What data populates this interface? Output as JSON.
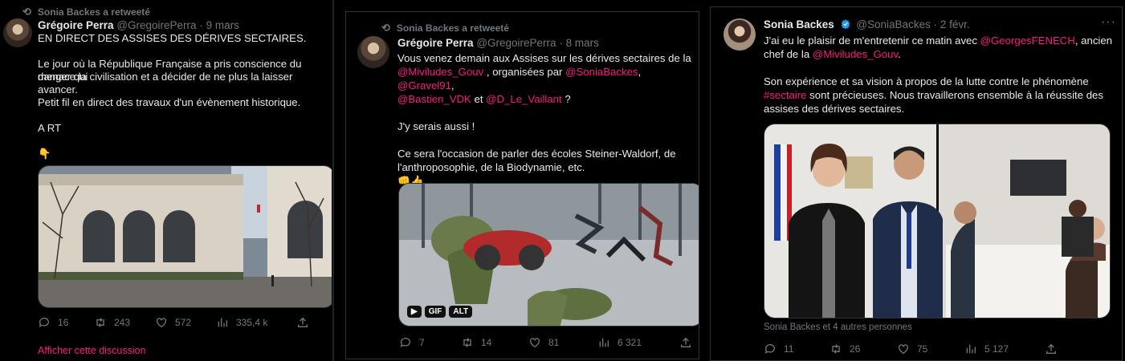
{
  "tweet1": {
    "retweet_label": "Sonia Backes a retweeté",
    "name": "Grégoire Perra",
    "handle": "@GregoirePerra",
    "sep": "·",
    "date": "9 mars",
    "lines": [
      "EN DIRECT DES ASSISES DES DÉRIVES SECTAIRES.",
      "",
      "Le jour où la République Française a pris conscience du danger qui",
      "menace la civilisation et a décider de ne plus la laisser avancer.",
      "",
      "Petit fil en direct des travaux d'un évènement historique.",
      "",
      "A RT",
      "",
      "👇"
    ],
    "replies": "16",
    "retweets": "243",
    "likes": "572",
    "views": "335,4 k",
    "show_thread": "Afficher cette discussion"
  },
  "tweet2": {
    "retweet_label": "Sonia Backes a retweeté",
    "name": "Grégoire Perra",
    "handle": "@GregoirePerra",
    "sep": "·",
    "date": "8 mars",
    "line1": "Vous venez demain aux Assises sur les dérives sectaires de la",
    "mention_miviludes": "@Miviludes_Gouv",
    "line2_mid": " , organisées par ",
    "mention_sonia": "@SoniaBackes",
    "comma": ", ",
    "mention_gravel": "@Gravel91",
    "comma2": ",",
    "mention_bastien": "@Bastien_VDK",
    "et": " et ",
    "mention_vaillant": "@D_Le_Vaillant",
    "q": " ?",
    "line4": "J'y serais aussi !",
    "line5": "Ce sera l'occasion de parler des écoles Steiner-Waldorf,  de",
    "line6": "l'anthroposophie, de la Biodynamie, etc.",
    "emoji": "👊👍",
    "gif_label": "GIF",
    "alt_label": "ALT",
    "replies": "7",
    "retweets": "14",
    "likes": "81",
    "views": "6 321"
  },
  "tweet3": {
    "name": "Sonia Backes",
    "handle": "@SoniaBackes",
    "sep": "·",
    "date": "2 févr.",
    "more": "···",
    "l1a": "J'ai eu le plaisir de m'entretenir ce matin avec ",
    "mention_fenech": "@GeorgesFENECH",
    "l1b": ", ancien",
    "l2a": "chef de la ",
    "mention_miviludes": "@Miviludes_Gouv",
    "l2b": ".",
    "l3": "Son expérience et sa vision à propos de la lutte contre le phénomène",
    "hashtag": "#sectaire",
    "l4b": " sont précieuses. Nous travaillerons ensemble à la réussite des",
    "l5": "assises des dérives sectaires.",
    "liked_by": "Sonia Backes et 4 autres personnes",
    "replies": "11",
    "retweets": "26",
    "likes": "75",
    "views": "5 127"
  },
  "colors": {
    "accent": "#f91880",
    "muted": "#71767b",
    "verified": "#1d9bf0"
  }
}
